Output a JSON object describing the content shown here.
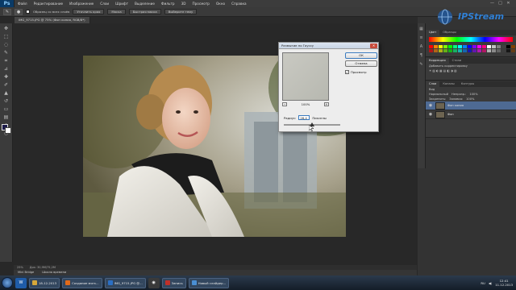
{
  "app": {
    "logo": "Ps",
    "menu": [
      "Файл",
      "Редактирование",
      "Изображение",
      "Слои",
      "Шрифт",
      "Выделение",
      "Фильтр",
      "3D",
      "Просмотр",
      "Окно",
      "Справка"
    ],
    "window_controls": [
      "—",
      "□",
      "✕"
    ]
  },
  "options_bar": {
    "checkbox_label": "Образец со всех слоёв",
    "buttons": [
      "Уточнить края",
      "Маска",
      "Быстрая маска",
      "Выберите тему"
    ]
  },
  "doc_tabs": [
    "IMG_9715.JPG @ 75% (Фон копия, RGB/8*)"
  ],
  "watermark": {
    "text": "IPStream"
  },
  "canvas": {
    "status_zoom": "25%",
    "status_doc": "Док: 30,9M/75,2M",
    "bottom_tabs": [
      "Mini Bridge",
      "Шкала времени"
    ]
  },
  "panels": {
    "color_tabs": [
      "Цвет",
      "Образцы"
    ],
    "adjust_tabs": [
      "Коррекция",
      "Стили"
    ],
    "adjust_title": "Добавить корректировку",
    "layers_tabs": [
      "Слои",
      "Каналы",
      "Контуры"
    ],
    "layers_kind": "Вид",
    "blend_mode": "Нормальный",
    "opacity_label": "Непрозр.:",
    "opacity_value": "100%",
    "lock_label": "Закрепить:",
    "fill_label": "Заливка:",
    "fill_value": "100%",
    "layers": [
      {
        "name": "Фон копия",
        "active": true
      },
      {
        "name": "Фон",
        "active": false
      }
    ]
  },
  "dialog": {
    "title": "Размытие по Гауссу",
    "ok_label": "ОК",
    "cancel_label": "Отмена",
    "preview_label": "Просмотр",
    "zoom_value": "100%",
    "radius_label": "Радиус:",
    "radius_value": "26,4",
    "radius_units": "Пикселы",
    "slider_fraction": 0.5
  },
  "taskbar": {
    "items": [
      {
        "label": "18-12-2013",
        "color": "#d26a20"
      },
      {
        "label": "Создание мягк...",
        "color": "#e06a1a"
      },
      {
        "label": "IMG_9715.JPG @...",
        "color": "#2b6fc4"
      },
      {
        "label": "Запись",
        "color": "#c0302a"
      },
      {
        "label": "Новый слайдер...",
        "color": "#4a8fd4"
      }
    ],
    "lang": "RU",
    "time": "12:41",
    "date": "11.12.2013"
  }
}
